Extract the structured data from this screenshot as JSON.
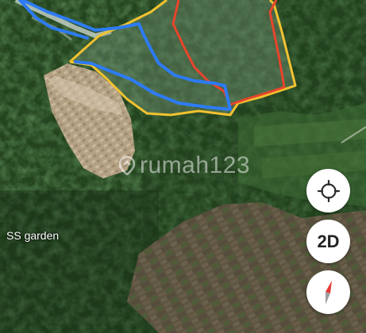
{
  "map": {
    "place_label": "SS garden",
    "watermark": "rumah123",
    "boundary_colors": {
      "yellow": "#f2c230",
      "red": "#e8452c",
      "blue": "#2d7bf4"
    }
  },
  "controls": {
    "locate_icon": "crosshair-locate-icon",
    "view_mode_label": "2D",
    "compass_icon": "compass-needle-icon"
  }
}
